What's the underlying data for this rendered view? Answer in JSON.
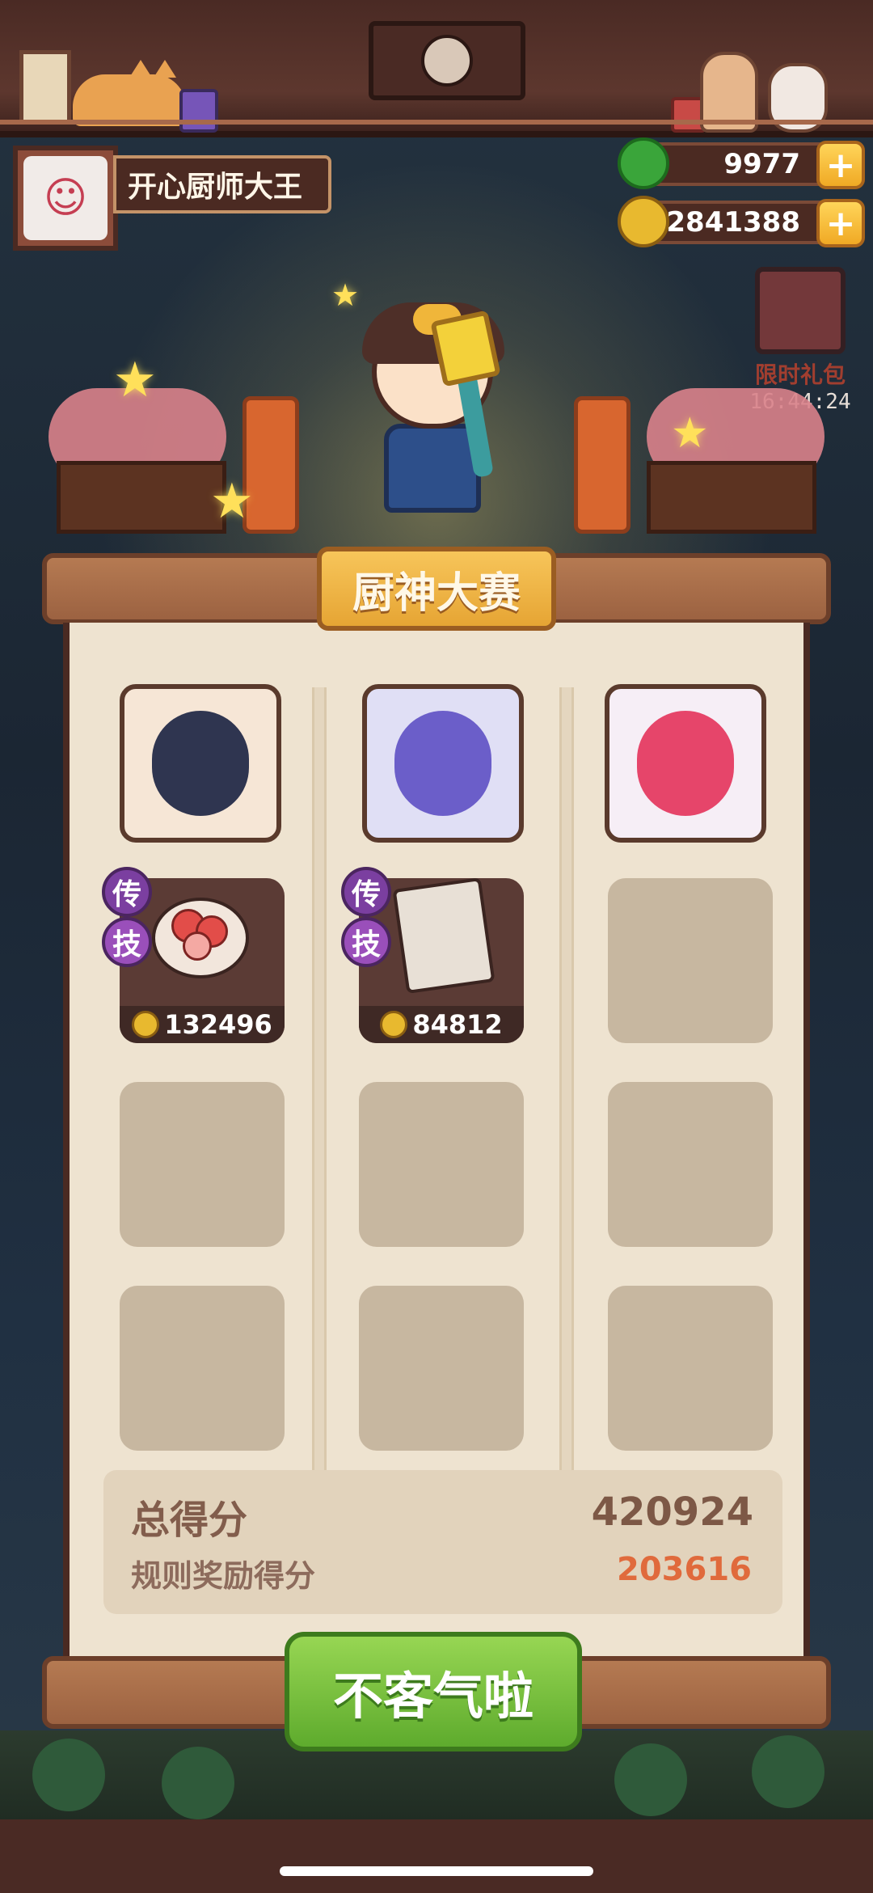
{
  "player": {
    "name": "开心厨师大王",
    "avatar_icon": "chef-girl-avatar"
  },
  "currencies": [
    {
      "name": "jade",
      "value": "9977",
      "icon": "jade-coin-icon",
      "color": "#3aa53a"
    },
    {
      "name": "gold",
      "value": "2841388",
      "icon": "gold-coin-icon",
      "color": "#e8b92f"
    }
  ],
  "limited_gift": {
    "label": "限时礼包",
    "timer": "16:44:24"
  },
  "contest": {
    "title": "厨神大赛",
    "columns": [
      {
        "portrait_icon": "scholar-chef-portrait",
        "slots": [
          {
            "filled": true,
            "badges": [
              "传",
              "技"
            ],
            "dish_icon": "fruit-platter-icon",
            "coins": "132496"
          },
          {
            "filled": false
          },
          {
            "filled": false
          }
        ]
      },
      {
        "portrait_icon": "three-eyed-chef-portrait",
        "slots": [
          {
            "filled": true,
            "badges": [
              "传",
              "技"
            ],
            "dish_icon": "scroll-recipe-icon",
            "coins": "84812"
          },
          {
            "filled": false
          },
          {
            "filled": false
          }
        ]
      },
      {
        "portrait_icon": "pink-hair-chef-portrait",
        "slots": [
          {
            "filled": false
          },
          {
            "filled": false
          },
          {
            "filled": false
          }
        ]
      }
    ],
    "total_score_label": "总得分",
    "total_score": "420924",
    "bonus_score_label": "规则奖励得分",
    "bonus_score": "203616"
  },
  "action_button": "不客气啦",
  "colors": {
    "accent_gold": "#f0b63a",
    "button_green": "#6bb534",
    "bonus_orange": "#e06a3c"
  }
}
